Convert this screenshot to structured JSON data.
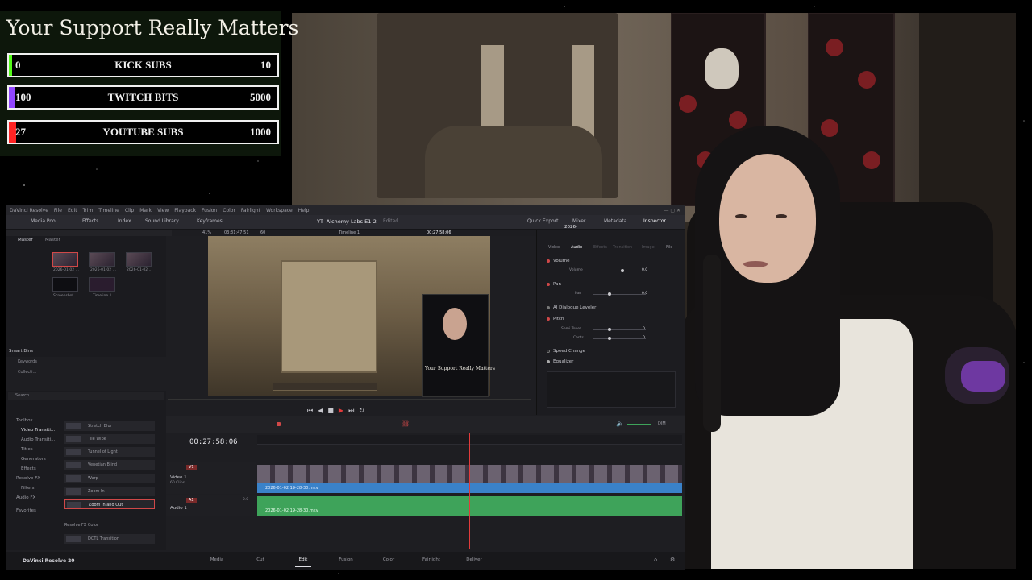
{
  "support_widget": {
    "title": "Your Support Really Matters",
    "goals": [
      {
        "min": "0",
        "label": "KICK SUBS",
        "max": "10",
        "progress": 0.0,
        "color": "#53fc18"
      },
      {
        "min": "100",
        "label": "TWITCH BITS",
        "max": "5000",
        "progress": 0.02,
        "color": "#9146ff"
      },
      {
        "min": "27",
        "label": "YOUTUBE SUBS",
        "max": "1000",
        "progress": 0.027,
        "color": "#ff2424"
      }
    ]
  },
  "resolve": {
    "menu": [
      "DaVinci Resolve",
      "File",
      "Edit",
      "Trim",
      "Timeline",
      "Clip",
      "Mark",
      "View",
      "Playback",
      "Fusion",
      "Color",
      "Fairlight",
      "Workspace",
      "Help"
    ],
    "toolbar": {
      "media_pool": "Media Pool",
      "effects": "Effects",
      "index": "Index",
      "sound_library": "Sound Library",
      "keyframes": "Keyframes",
      "project_title": "YT- Alchemy Labs E1-2",
      "edited": "Edited",
      "quick_export": "Quick Export",
      "mixer": "Mixer",
      "metadata": "Metadata",
      "inspector": "Inspector"
    },
    "viewer_bar": {
      "zoom": "41%",
      "duration": "03:31:47:51",
      "fps": "60",
      "timeline_name": "Timeline 1",
      "timecode": "00:27:58:06",
      "clip_name": "2026-01-02 19-28-30.mkv"
    },
    "media_pool": {
      "tabs": [
        "Master",
        "Master"
      ],
      "clips": [
        "2026-01-02 ...",
        "2026-01-02 ...",
        "2026-01-02 ...",
        "Screenshot ...",
        "Timeline 1"
      ],
      "smart_bins": "Smart Bins",
      "keywords": "Keywords",
      "collections": "Collecti..."
    },
    "viewer_overlay_title": "Your Support Really Matters",
    "inspector": {
      "tabs": [
        "Video",
        "Audio",
        "Effects",
        "Transition",
        "Image",
        "File"
      ],
      "sections": {
        "volume": "Volume",
        "volume_label": "Volume",
        "volume_value": "0.0",
        "pan": "Pan",
        "pan_label": "Pan",
        "pan_value": "0.0",
        "ai_dialogue": "AI Dialogue Leveler",
        "pitch": "Pitch",
        "semi_tones": "Semi Tones",
        "semi_tones_value": "0",
        "cents": "Cents",
        "cents_value": "0",
        "speed_change": "Speed Change",
        "equalizer": "Equalizer"
      }
    },
    "effects_panel": {
      "search_placeholder": "Search",
      "categories": [
        "Toolbox",
        "Video Transiti...",
        "Audio Transiti...",
        "Titles",
        "Generators",
        "Effects",
        "Resolve FX",
        "Filters",
        "Audio FX",
        "Favorites"
      ],
      "items": [
        "Stretch Blur",
        "Tile Wipe",
        "Tunnel of Light",
        "Venetian Blind",
        "Warp",
        "Zoom In",
        "Zoom In and Out"
      ],
      "resolve_fx_color": "Resolve FX Color",
      "dctl": "DCTL Transition"
    },
    "timeline": {
      "timecode": "00:27:58:06",
      "ruler_time": "00:27:58:06",
      "video_track": {
        "id": "V1",
        "name": "Video 1",
        "clips": "60 Clips"
      },
      "audio_track": {
        "id": "A1",
        "name": "Audio 1",
        "channels": "2.0"
      },
      "video_clip": "2026-01-02 19-28-30.mkv",
      "audio_clip": "2026-01-02 19-28-30.mkv",
      "dim": "DIM"
    },
    "pages": [
      "Media",
      "Cut",
      "Edit",
      "Fusion",
      "Color",
      "Fairlight",
      "Deliver"
    ],
    "active_page": "Edit",
    "brand": "DaVinci Resolve 20"
  }
}
